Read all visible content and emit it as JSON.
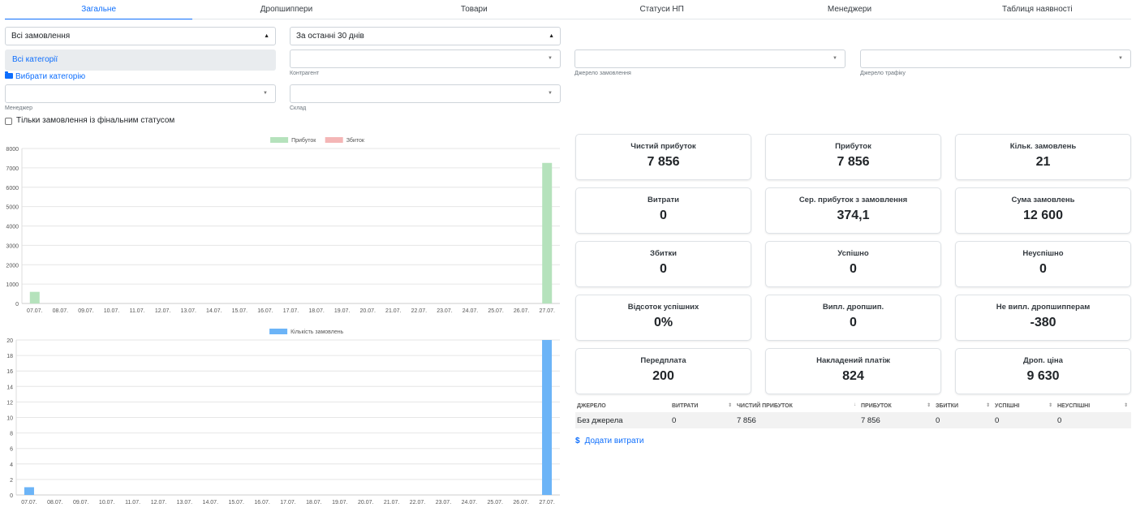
{
  "tabs": [
    {
      "label": "Загальне",
      "active": true
    },
    {
      "label": "Дропшиппери",
      "active": false
    },
    {
      "label": "Товари",
      "active": false
    },
    {
      "label": "Статуси НП",
      "active": false
    },
    {
      "label": "Менеджери",
      "active": false
    },
    {
      "label": "Таблиця наявності",
      "active": false
    }
  ],
  "filters": {
    "orders_select": "Всі замовлення",
    "period_select": "За останні 30 днів",
    "category_box": "Всі категорії",
    "choose_category": "Вибрати категорію",
    "counterparty_label": "Контрагент",
    "order_source_label": "Джерело замовлення",
    "traffic_source_label": "Джерело трафіку",
    "manager_label": "Менеджер",
    "warehouse_label": "Склад",
    "final_status_checkbox": "Тільки замовлення із фінальним статусом"
  },
  "colors": {
    "accent": "#0d6efd",
    "profit": "#b5e2bc",
    "loss": "#f4b6b6",
    "orders": "#6cb4f7"
  },
  "chart_data": [
    {
      "type": "bar",
      "legend_position": "top-center",
      "categories": [
        "07.07.",
        "08.07.",
        "09.07.",
        "10.07.",
        "11.07.",
        "12.07.",
        "13.07.",
        "14.07.",
        "15.07.",
        "16.07.",
        "17.07.",
        "18.07.",
        "19.07.",
        "20.07.",
        "21.07.",
        "22.07.",
        "23.07.",
        "24.07.",
        "25.07.",
        "26.07.",
        "27.07."
      ],
      "series": [
        {
          "name": "Прибуток",
          "color": "#b5e2bc",
          "values": [
            600,
            0,
            0,
            0,
            0,
            0,
            0,
            0,
            0,
            0,
            0,
            0,
            0,
            0,
            0,
            0,
            0,
            0,
            0,
            0,
            7256
          ]
        },
        {
          "name": "Збиток",
          "color": "#f4b6b6",
          "values": [
            0,
            0,
            0,
            0,
            0,
            0,
            0,
            0,
            0,
            0,
            0,
            0,
            0,
            0,
            0,
            0,
            0,
            0,
            0,
            0,
            0
          ]
        }
      ],
      "yticks": [
        0,
        1000,
        2000,
        3000,
        4000,
        5000,
        6000,
        7000,
        8000
      ],
      "ylim": [
        0,
        8000
      ],
      "grid": true
    },
    {
      "type": "bar",
      "legend_position": "top-center",
      "categories": [
        "07.07.",
        "08.07.",
        "09.07.",
        "10.07.",
        "11.07.",
        "12.07.",
        "13.07.",
        "14.07.",
        "15.07.",
        "16.07.",
        "17.07.",
        "18.07.",
        "19.07.",
        "20.07.",
        "21.07.",
        "22.07.",
        "23.07.",
        "24.07.",
        "25.07.",
        "26.07.",
        "27.07."
      ],
      "series": [
        {
          "name": "Кількість замовлень",
          "color": "#6cb4f7",
          "values": [
            1,
            0,
            0,
            0,
            0,
            0,
            0,
            0,
            0,
            0,
            0,
            0,
            0,
            0,
            0,
            0,
            0,
            0,
            0,
            0,
            20
          ]
        }
      ],
      "yticks": [
        0,
        2,
        4,
        6,
        8,
        10,
        12,
        14,
        16,
        18,
        20
      ],
      "ylim": [
        0,
        20
      ],
      "grid": true
    }
  ],
  "cards": [
    {
      "label": "Чистий прибуток",
      "value": "7 856"
    },
    {
      "label": "Прибуток",
      "value": "7 856"
    },
    {
      "label": "Кільк. замовлень",
      "value": "21"
    },
    {
      "label": "Витрати",
      "value": "0"
    },
    {
      "label": "Сер. прибуток з замовлення",
      "value": "374,1"
    },
    {
      "label": "Сума замовлень",
      "value": "12 600"
    },
    {
      "label": "Збитки",
      "value": "0"
    },
    {
      "label": "Успішно",
      "value": "0"
    },
    {
      "label": "Неуспішно",
      "value": "0"
    },
    {
      "label": "Відсоток успішних",
      "value": "0%"
    },
    {
      "label": "Випл. дропшип.",
      "value": "0"
    },
    {
      "label": "Не випл. дропшипперам",
      "value": "-380"
    },
    {
      "label": "Передплата",
      "value": "200"
    },
    {
      "label": "Накладений платіж",
      "value": "824"
    },
    {
      "label": "Дроп. ціна",
      "value": "9 630"
    }
  ],
  "source_table": {
    "headers": [
      "ДЖЕРЕЛО",
      "ВИТРАТИ",
      "ЧИСТИЙ ПРИБУТОК",
      "ПРИБУТОК",
      "ЗБИТКИ",
      "УСПІШНІ",
      "НЕУСПІШНІ"
    ],
    "rows": [
      [
        "Без джерела",
        "0",
        "7 856",
        "7 856",
        "0",
        "0",
        "0"
      ]
    ]
  },
  "add_expenses": "Додати витрати"
}
